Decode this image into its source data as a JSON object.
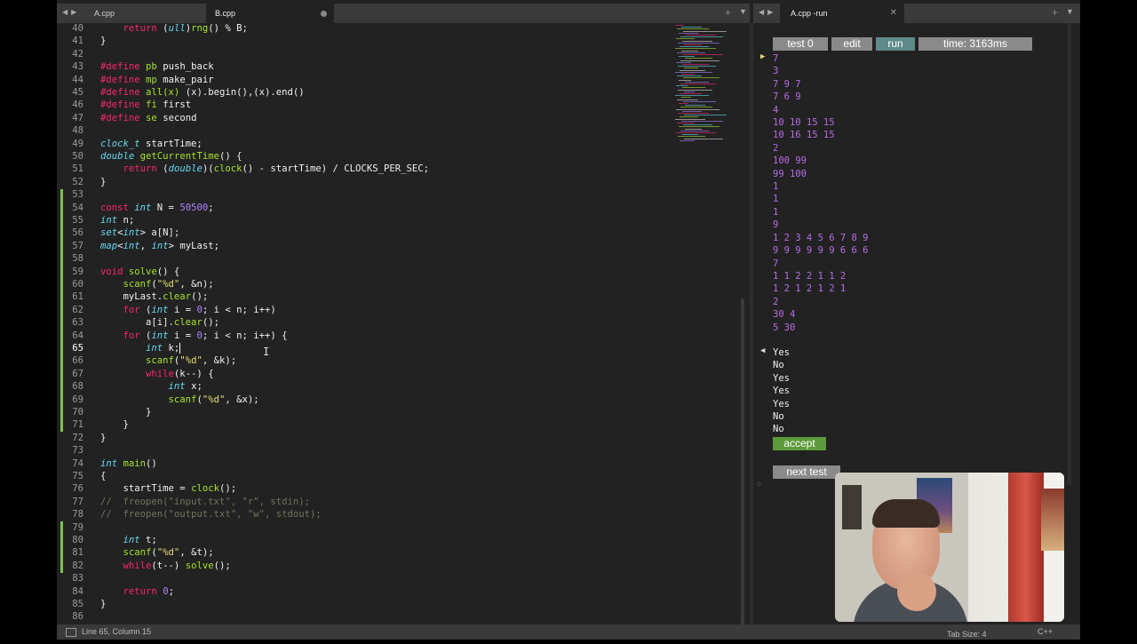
{
  "tabs_left": {
    "tab1": "A.cpp",
    "tab2": "B.cpp"
  },
  "tabs_right": {
    "tab1": "A.cpp -run"
  },
  "editor": {
    "lines": [
      {
        "n": "40",
        "code": "    return (ull)rng() % B;"
      },
      {
        "n": "41",
        "code": "}"
      },
      {
        "n": "42",
        "code": ""
      },
      {
        "n": "43",
        "code": "#define pb push_back"
      },
      {
        "n": "44",
        "code": "#define mp make_pair"
      },
      {
        "n": "45",
        "code": "#define all(x) (x).begin(),(x).end()"
      },
      {
        "n": "46",
        "code": "#define fi first"
      },
      {
        "n": "47",
        "code": "#define se second"
      },
      {
        "n": "48",
        "code": ""
      },
      {
        "n": "49",
        "code": "clock_t startTime;"
      },
      {
        "n": "50",
        "code": "double getCurrentTime() {"
      },
      {
        "n": "51",
        "code": "    return (double)(clock() - startTime) / CLOCKS_PER_SEC;"
      },
      {
        "n": "52",
        "code": "}"
      },
      {
        "n": "53",
        "code": ""
      },
      {
        "n": "54",
        "code": "const int N = 50500;"
      },
      {
        "n": "55",
        "code": "int n;"
      },
      {
        "n": "56",
        "code": "set<int> a[N];"
      },
      {
        "n": "57",
        "code": "map<int, int> myLast;"
      },
      {
        "n": "58",
        "code": ""
      },
      {
        "n": "59",
        "code": "void solve() {"
      },
      {
        "n": "60",
        "code": "    scanf(\"%d\", &n);"
      },
      {
        "n": "61",
        "code": "    myLast.clear();"
      },
      {
        "n": "62",
        "code": "    for (int i = 0; i < n; i++)"
      },
      {
        "n": "63",
        "code": "        a[i].clear();"
      },
      {
        "n": "64",
        "code": "    for (int i = 0; i < n; i++) {"
      },
      {
        "n": "65",
        "code": "        int k;"
      },
      {
        "n": "66",
        "code": "        scanf(\"%d\", &k);"
      },
      {
        "n": "67",
        "code": "        while(k--) {"
      },
      {
        "n": "68",
        "code": "            int x;"
      },
      {
        "n": "69",
        "code": "            scanf(\"%d\", &x);"
      },
      {
        "n": "70",
        "code": "        }"
      },
      {
        "n": "71",
        "code": "    }"
      },
      {
        "n": "72",
        "code": "}"
      },
      {
        "n": "73",
        "code": ""
      },
      {
        "n": "74",
        "code": "int main()"
      },
      {
        "n": "75",
        "code": "{"
      },
      {
        "n": "76",
        "code": "    startTime = clock();"
      },
      {
        "n": "77",
        "code": "//  freopen(\"input.txt\", \"r\", stdin);"
      },
      {
        "n": "78",
        "code": "//  freopen(\"output.txt\", \"w\", stdout);"
      },
      {
        "n": "79",
        "code": ""
      },
      {
        "n": "80",
        "code": "    int t;"
      },
      {
        "n": "81",
        "code": "    scanf(\"%d\", &t);"
      },
      {
        "n": "82",
        "code": "    while(t--) solve();"
      },
      {
        "n": "83",
        "code": ""
      },
      {
        "n": "84",
        "code": "    return 0;"
      },
      {
        "n": "85",
        "code": "}"
      },
      {
        "n": "86",
        "code": ""
      }
    ]
  },
  "runner": {
    "test_label": "test 0",
    "edit_label": "edit",
    "run_label": "run",
    "time_label": "time: 3163ms",
    "input_lines": [
      "7",
      "3",
      "7 9 7",
      "7 6 9",
      "4",
      "10 10 15 15",
      "10 16 15 15",
      "2",
      "100 99",
      "99 100",
      "1",
      "1",
      "1",
      "9",
      "1 2 3 4 5 6 7 8 9",
      "9 9 9 9 9 9 6 6 6",
      "7",
      "1 1 2 2 1 1 2",
      "1 2 1 2 1 2 1",
      "2",
      "30 4",
      "5 30"
    ],
    "output_lines": [
      "Yes",
      "No",
      "Yes",
      "Yes",
      "Yes",
      "No",
      "No"
    ],
    "accept_label": "accept",
    "next_test_label": "next test"
  },
  "status": {
    "position": "Line 65, Column 15",
    "tab_size": "Tab Size: 4",
    "syntax": "C++"
  },
  "colors": {
    "keyword": "#f92672",
    "type": "#66d9ef",
    "number": "#ae81ff",
    "string": "#e6db74",
    "function": "#a6e22e",
    "comment": "#75715e",
    "input_text": "#b76de6",
    "accept_button": "#5c9a3a"
  }
}
